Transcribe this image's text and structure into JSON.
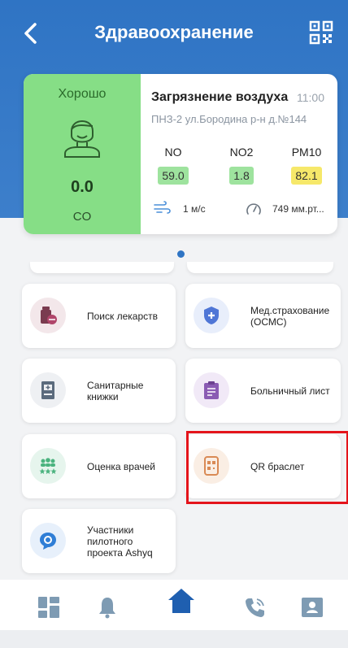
{
  "header": {
    "title": "Здравоохранение",
    "back_icon": "chevron-left-icon",
    "qr_icon": "qr-code-icon"
  },
  "air_quality": {
    "status": "Хорошо",
    "value": "0.0",
    "unit": "CO",
    "title": "Загрязнение воздуха",
    "time": "11:00",
    "station": "ПНЗ-2 ул.Бородина р-н д.№144",
    "pollutants": [
      {
        "name": "NO",
        "value": "59.0",
        "color": "green"
      },
      {
        "name": "NO2",
        "value": "1.8",
        "color": "green"
      },
      {
        "name": "PM10",
        "value": "82.1",
        "color": "yellow"
      }
    ],
    "wind": "1 м/с",
    "pressure": "749 мм.рт...",
    "panel_color": "#86de86"
  },
  "services": [
    {
      "label": "Поиск лекарств",
      "icon": "medicine-icon",
      "icon_color": "#7a3b4f"
    },
    {
      "label": "Мед.страхование (ОСМС)",
      "icon": "shield-cross-icon",
      "icon_color": "#4f76d6"
    },
    {
      "label": "Санитарные книжки",
      "icon": "book-icon",
      "icon_color": "#5b6b7d"
    },
    {
      "label": "Больничный лист",
      "icon": "clipboard-icon",
      "icon_color": "#8a5bb3"
    },
    {
      "label": "Оценка врачей",
      "icon": "rating-icon",
      "icon_color": "#4bb37f"
    },
    {
      "label": "QR браслет",
      "icon": "qr-bracelet-icon",
      "icon_color": "#d98a55"
    },
    {
      "label": "Участники пилотного проекта Ashyq",
      "icon": "chat-icon",
      "icon_color": "#2f7ed6"
    }
  ],
  "bottom_nav": [
    {
      "name": "dashboard-icon"
    },
    {
      "name": "bell-icon"
    },
    {
      "name": "home-icon"
    },
    {
      "name": "phone-icon"
    },
    {
      "name": "contact-card-icon"
    }
  ],
  "colors": {
    "primary": "#2f74c4",
    "highlight": "#e4141b"
  }
}
